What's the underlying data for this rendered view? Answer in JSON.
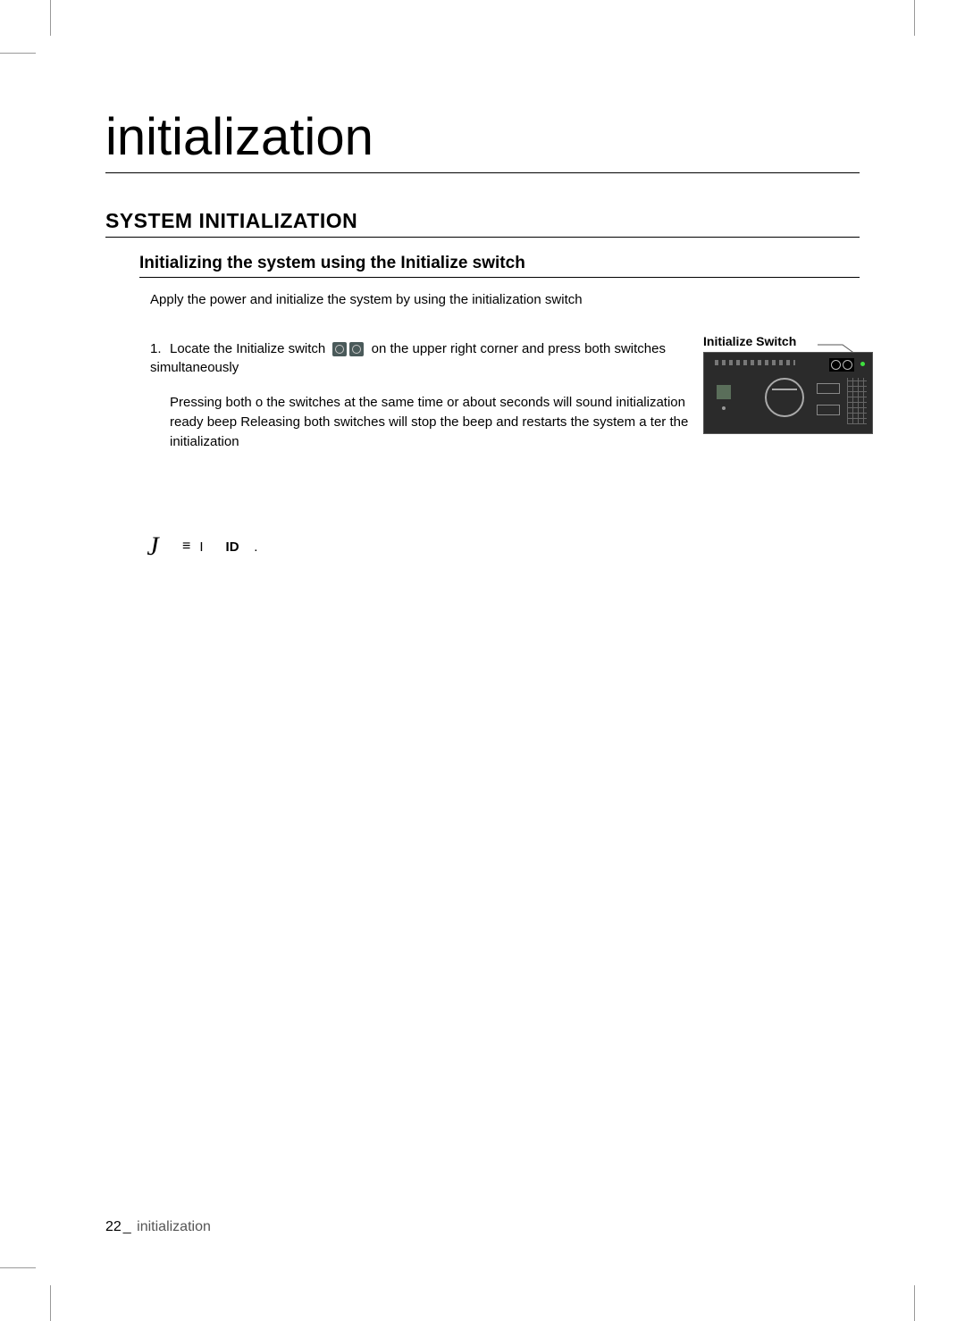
{
  "title": "initialization",
  "section_heading": "SYSTEM INITIALIZATION",
  "subheading": "Initializing the system using the Initialize switch",
  "intro": "Apply the power and initialize the system by using the initialization switch",
  "step1_num": "1.",
  "step1_a": "Locate the Initialize switch",
  "step1_b": "on the upper right corner and press both switches simultaneously",
  "step1_detail": "Pressing both o  the switches at the same time  or about   seconds will sound initialization ready beep  Releasing both switches will stop the beep and restarts the system a ter the initialization",
  "figure_label": "Initialize Switch",
  "note_symbol": "J",
  "note_bullet": "≡",
  "note_text_parts": {
    "pre": "I",
    "bold": "ID",
    "post": "."
  },
  "footer": {
    "page_num": "22",
    "separator": "_",
    "section": "initialization"
  }
}
